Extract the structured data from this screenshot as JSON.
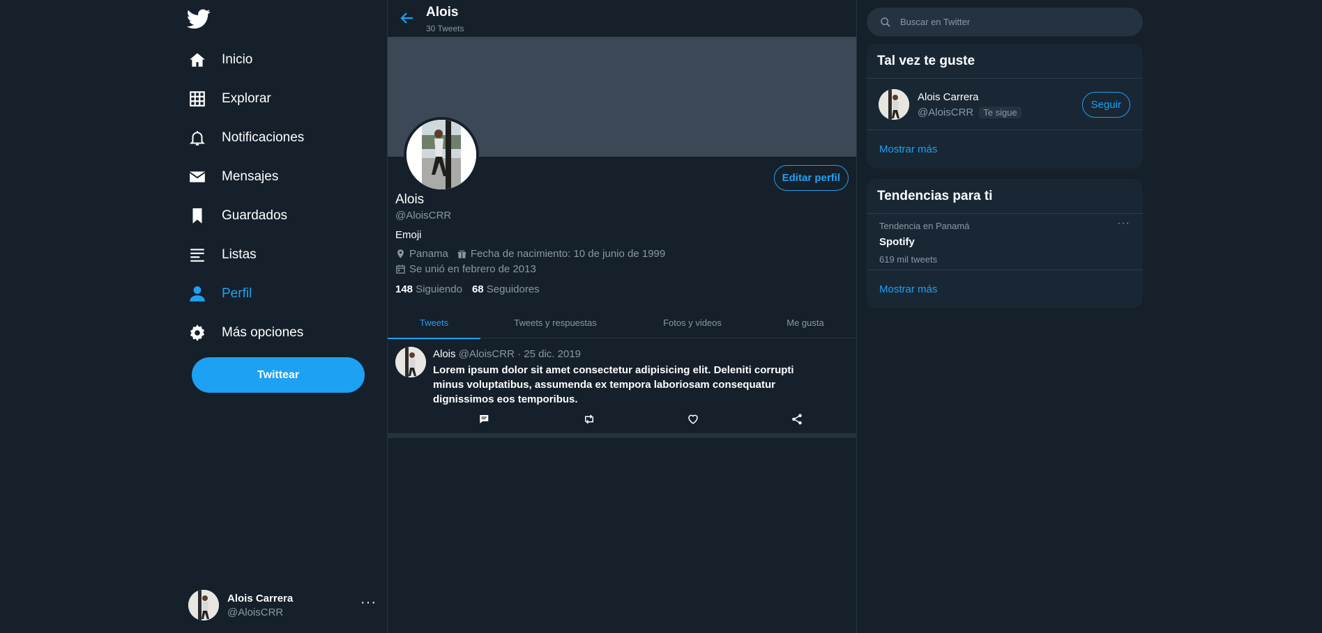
{
  "brand": {
    "accent": "#1da1f2",
    "background": "#15202b",
    "card": "#192734",
    "muted": "#8899a6"
  },
  "sidebar": {
    "logo_icon": "twitter-bird-icon",
    "items": [
      {
        "label": "Inicio",
        "icon": "home-icon"
      },
      {
        "label": "Explorar",
        "icon": "hashtag-icon"
      },
      {
        "label": "Notificaciones",
        "icon": "bell-icon"
      },
      {
        "label": "Mensajes",
        "icon": "envelope-icon"
      },
      {
        "label": "Guardados",
        "icon": "bookmark-icon"
      },
      {
        "label": "Listas",
        "icon": "list-icon"
      },
      {
        "label": "Perfil",
        "icon": "person-icon",
        "active": true
      },
      {
        "label": "Más opciones",
        "icon": "gear-icon"
      }
    ],
    "tweet_button": "Twittear",
    "account": {
      "name": "Alois Carrera",
      "handle": "@AloisCRR",
      "more": "···"
    }
  },
  "header": {
    "name": "Alois",
    "tweet_count": "30 Tweets"
  },
  "profile": {
    "name": "Alois",
    "handle": "@AloisCRR",
    "bio": "Emoji",
    "location": "Panama",
    "birthday": "Fecha de nacimiento: 10 de junio de 1999",
    "joined": "Se unió en febrero de 2013",
    "following_count": "148",
    "following_label": "Siguiendo",
    "followers_count": "68",
    "followers_label": "Seguidores",
    "edit_button": "Editar perfil"
  },
  "tabs": [
    {
      "label": "Tweets",
      "active": true
    },
    {
      "label": "Tweets y respuestas"
    },
    {
      "label": "Fotos y videos"
    },
    {
      "label": "Me gusta"
    }
  ],
  "tweet": {
    "name": "Alois",
    "handle": "@AloisCRR",
    "date": "· 25 dic. 2019",
    "text": "Lorem ipsum dolor sit amet consectetur adipisicing elit. Deleniti corrupti minus voluptatibus, assumenda ex tempora laboriosam consequatur dignissimos eos temporibus.",
    "actions": [
      "reply-icon",
      "retweet-icon",
      "heart-icon",
      "share-icon"
    ]
  },
  "search": {
    "placeholder": "Buscar en Twitter"
  },
  "who_to_follow": {
    "title": "Tal vez te guste",
    "user": {
      "name": "Alois Carrera",
      "handle": "@AloisCRR",
      "badge": "Te sigue",
      "button": "Seguir"
    },
    "more": "Mostrar más"
  },
  "trends": {
    "title": "Tendencias para ti",
    "items": [
      {
        "context": "Tendencia en Panamá",
        "name": "Spotify",
        "count": "619 mil tweets",
        "more": "···"
      }
    ],
    "more": "Mostrar más"
  }
}
